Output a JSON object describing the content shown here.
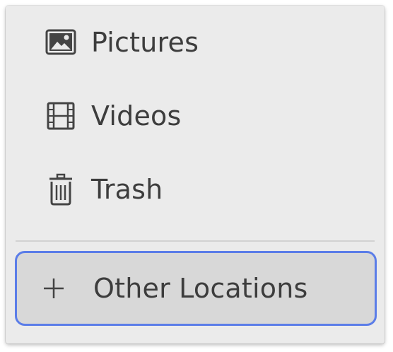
{
  "sidebar": {
    "items": [
      {
        "label": "Pictures",
        "icon": "pictures-icon"
      },
      {
        "label": "Videos",
        "icon": "videos-icon"
      },
      {
        "label": "Trash",
        "icon": "trash-icon"
      }
    ],
    "other_locations": {
      "label": "Other Locations",
      "icon": "plus-icon"
    }
  },
  "colors": {
    "focus_ring": "#5b7de8",
    "panel_bg": "#ebebeb",
    "selected_bg": "#d8d8d8",
    "text": "#3d3d3d"
  }
}
